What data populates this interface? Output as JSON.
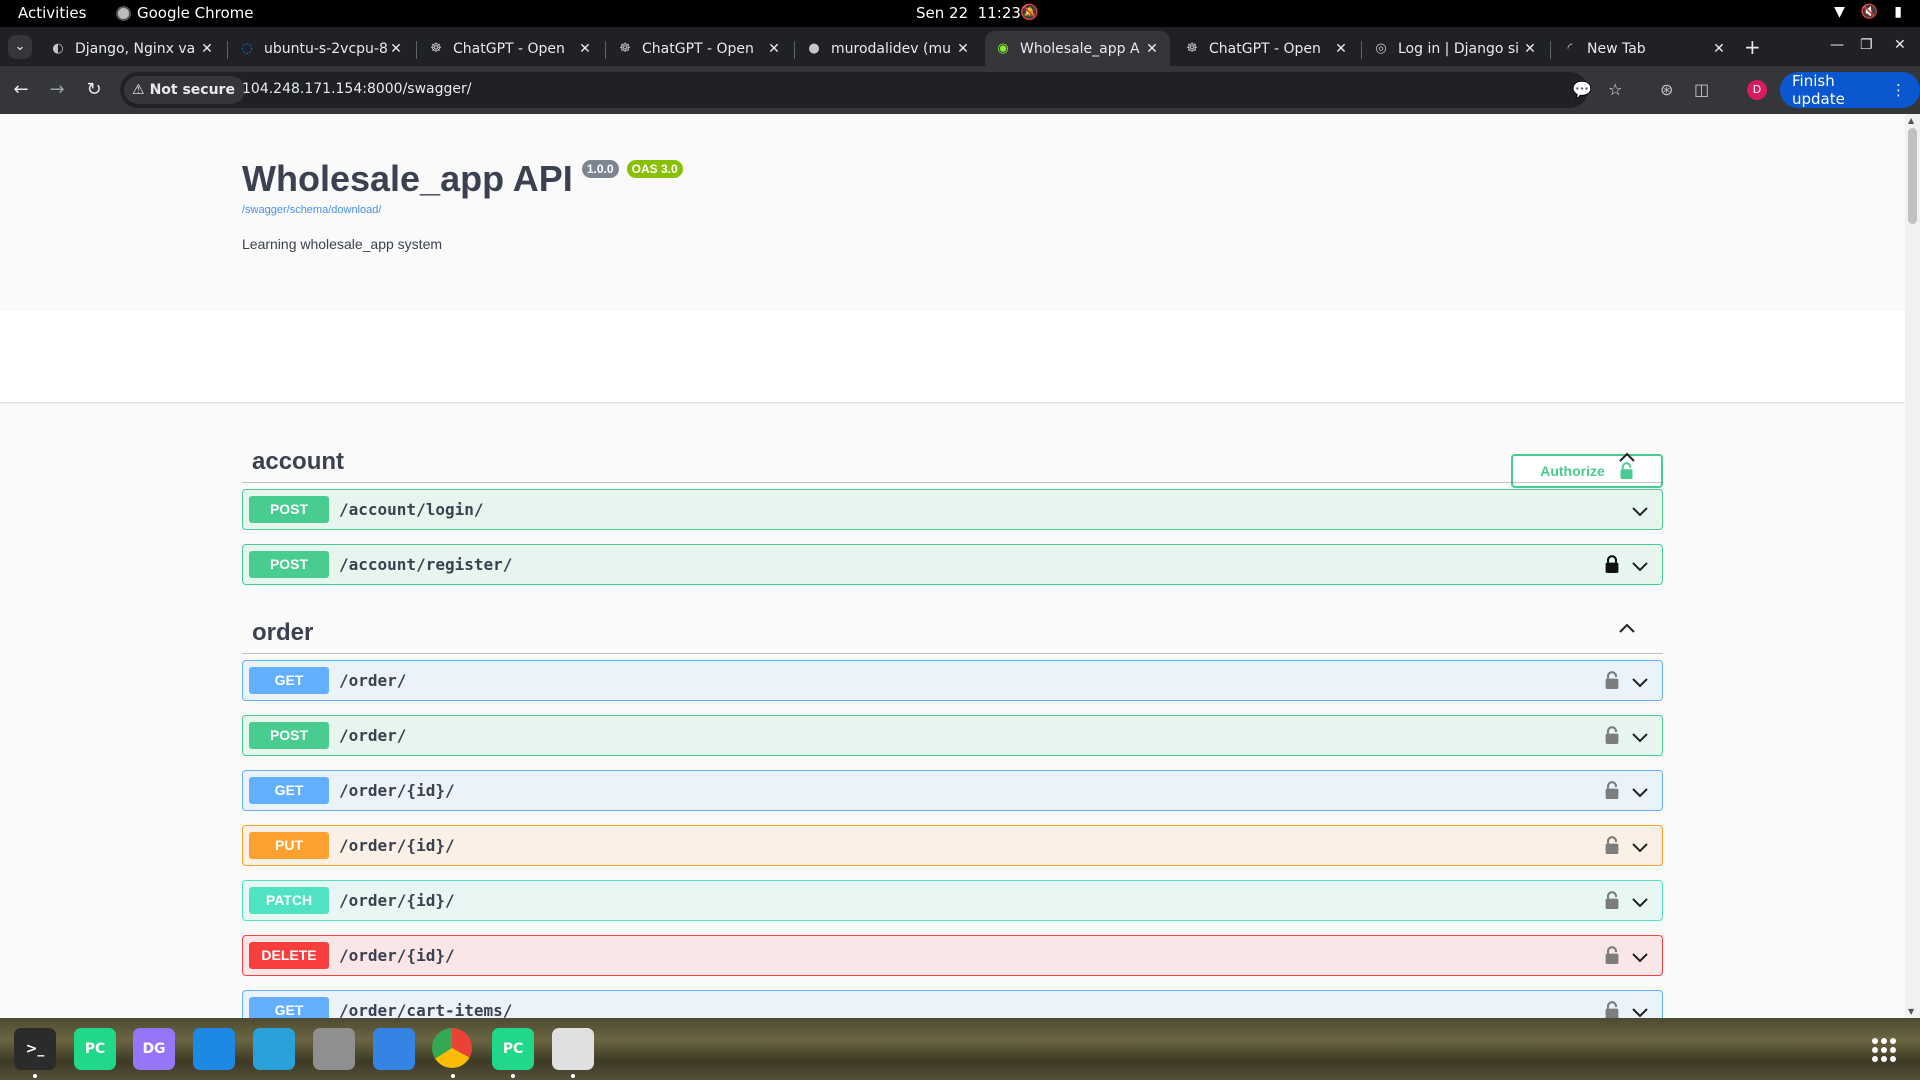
{
  "topbar": {
    "activities": "Activities",
    "app_name": "Google Chrome",
    "date": "Sen 22",
    "time": "11:23"
  },
  "tabs": [
    {
      "title": "Django, Nginx va",
      "icon": "django-icon"
    },
    {
      "title": "ubuntu-s-2vcpu-8",
      "icon": "digitalocean-icon"
    },
    {
      "title": "ChatGPT - Open",
      "icon": "openai-icon"
    },
    {
      "title": "ChatGPT - Open",
      "icon": "openai-icon"
    },
    {
      "title": "murodalidev (mu",
      "icon": "github-icon"
    },
    {
      "title": "Wholesale_app A",
      "icon": "swagger-icon",
      "active": true
    },
    {
      "title": "ChatGPT - Open",
      "icon": "openai-icon"
    },
    {
      "title": "Log in | Django si",
      "icon": "globe-icon"
    },
    {
      "title": "New Tab",
      "icon": "loading-icon"
    }
  ],
  "toolbar": {
    "security_label": "Not secure",
    "url": "104.248.171.154:8000/swagger/",
    "finish_update": "Finish update",
    "profile_initial": "D"
  },
  "api": {
    "title": "Wholesale_app API",
    "version": "1.0.0",
    "oas": "OAS 3.0",
    "schema_link": "/swagger/schema/download/",
    "description": "Learning wholesale_app system",
    "authorize_label": "Authorize"
  },
  "groups": [
    {
      "name": "account",
      "operations": [
        {
          "method": "POST",
          "path": "/account/login/",
          "locked": false
        },
        {
          "method": "POST",
          "path": "/account/register/",
          "locked": true,
          "lock_closed": true
        }
      ]
    },
    {
      "name": "order",
      "operations": [
        {
          "method": "GET",
          "path": "/order/",
          "locked": true
        },
        {
          "method": "POST",
          "path": "/order/",
          "locked": true
        },
        {
          "method": "GET",
          "path": "/order/{id}/",
          "locked": true
        },
        {
          "method": "PUT",
          "path": "/order/{id}/",
          "locked": true
        },
        {
          "method": "PATCH",
          "path": "/order/{id}/",
          "locked": true
        },
        {
          "method": "DELETE",
          "path": "/order/{id}/",
          "locked": true
        },
        {
          "method": "GET",
          "path": "/order/cart-items/",
          "locked": true
        }
      ]
    }
  ],
  "dock": [
    {
      "name": "terminal-icon",
      "label": ">_",
      "color": "#2b2b2b"
    },
    {
      "name": "pycharm-icon",
      "label": "PC",
      "color": "#21d789"
    },
    {
      "name": "datagrip-icon",
      "label": "DG",
      "color": "#9775f8"
    },
    {
      "name": "vscode-icon",
      "label": "",
      "color": "#1e88e5"
    },
    {
      "name": "telegram-icon",
      "label": "",
      "color": "#2aa1da"
    },
    {
      "name": "files-icon",
      "label": "",
      "color": "#8f8f8f"
    },
    {
      "name": "text-editor-icon",
      "label": "",
      "color": "#3584e4"
    },
    {
      "name": "chrome-icon",
      "label": "",
      "color": "#ea4335"
    },
    {
      "name": "pycharm-icon-2",
      "label": "PC",
      "color": "#21d789"
    },
    {
      "name": "gedit-icon",
      "label": "",
      "color": "#e0e0e0"
    }
  ]
}
